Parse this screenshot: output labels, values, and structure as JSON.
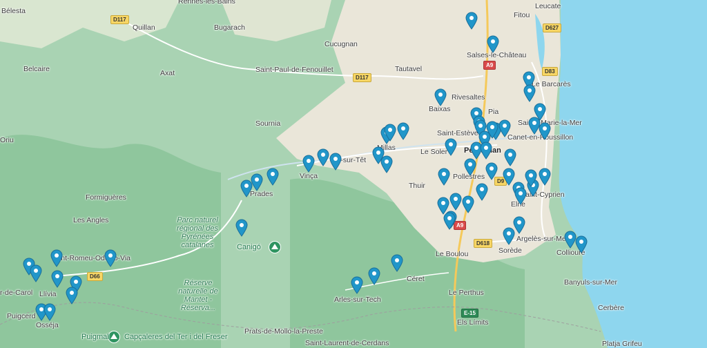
{
  "map": {
    "colors": {
      "sea": "#8ed6ee",
      "lowland": "#eae6d9",
      "mountain": "#a9d3b3",
      "forest": "#8fc69d",
      "road": "#ffffff",
      "highway": "#f5c95a",
      "pin": "#2196c9"
    },
    "places": [
      {
        "id": "belesta",
        "name": "Bélesta"
      },
      {
        "id": "rennes",
        "name": "Rennes-les-Bains"
      },
      {
        "id": "quillan",
        "name": "Quillan"
      },
      {
        "id": "bugarach",
        "name": "Bugarach"
      },
      {
        "id": "cucugnan",
        "name": "Cucugnan"
      },
      {
        "id": "fitou",
        "name": "Fitou"
      },
      {
        "id": "leucate",
        "name": "Leucate"
      },
      {
        "id": "salses",
        "name": "Salses-le-Château"
      },
      {
        "id": "belcaire",
        "name": "Belcaire"
      },
      {
        "id": "axat",
        "name": "Axat"
      },
      {
        "id": "stpaul",
        "name": "Saint-Paul-de-Fenouillet"
      },
      {
        "id": "tautavel",
        "name": "Tautavel"
      },
      {
        "id": "barcares",
        "name": "Le Barcarès"
      },
      {
        "id": "rivesaltes",
        "name": "Rivesaltes"
      },
      {
        "id": "baixas",
        "name": "Baixas"
      },
      {
        "id": "pia",
        "name": "Pia"
      },
      {
        "id": "stlaurent",
        "name": "Sainte-Marie-la-Mer"
      },
      {
        "id": "sournia",
        "name": "Sournia"
      },
      {
        "id": "stesteve",
        "name": "Saint-Estève"
      },
      {
        "id": "canet",
        "name": "Canet-en-Roussillon"
      },
      {
        "id": "oriu",
        "name": "Oriu"
      },
      {
        "id": "millas",
        "name": "Millas"
      },
      {
        "id": "lesoler",
        "name": "Le Soler"
      },
      {
        "id": "perpignan",
        "name": "Perpignan"
      },
      {
        "id": "ille",
        "name": "Ille-sur-Têt"
      },
      {
        "id": "vinca",
        "name": "Vinça"
      },
      {
        "id": "pollestres",
        "name": "Pollestres"
      },
      {
        "id": "thuir",
        "name": "Thuir"
      },
      {
        "id": "prades",
        "name": "Prades"
      },
      {
        "id": "stcyprien",
        "name": "Saint-Cyprien"
      },
      {
        "id": "formigueres",
        "name": "Formiguères"
      },
      {
        "id": "elne",
        "name": "Elne"
      },
      {
        "id": "lesangles",
        "name": "Les Angles"
      },
      {
        "id": "argeles",
        "name": "Argelès-sur-Mer"
      },
      {
        "id": "collioure",
        "name": "Collioure"
      },
      {
        "id": "sorede",
        "name": "Sorède"
      },
      {
        "id": "leboulou",
        "name": "Le Boulou"
      },
      {
        "id": "fontromeu",
        "name": "Font-Romeu-Odeillo-Via"
      },
      {
        "id": "ceret",
        "name": "Céret"
      },
      {
        "id": "banyuls",
        "name": "Banyuls-sur-Mer"
      },
      {
        "id": "bourgmadame",
        "name": "r-de-Carol"
      },
      {
        "id": "llivia",
        "name": "Llívia"
      },
      {
        "id": "arles",
        "name": "Arles-sur-Tech"
      },
      {
        "id": "leperthus",
        "name": "Le Perthus"
      },
      {
        "id": "cerbere",
        "name": "Cerbère"
      },
      {
        "id": "puigcerda",
        "name": "Puigcerd"
      },
      {
        "id": "osseja",
        "name": "Osséja"
      },
      {
        "id": "leslimits",
        "name": "Els Límits"
      },
      {
        "id": "pratsmollo",
        "name": "Prats-de-Mollo-la-Preste"
      },
      {
        "id": "stlaurentcerdans",
        "name": "Saint-Laurent-de-Cerdans"
      },
      {
        "id": "platja",
        "name": "Platja Grifeu"
      }
    ],
    "parks": [
      {
        "id": "pyrenees",
        "name": "Parc naturel régional des Pyrénées catalanes"
      },
      {
        "id": "mantet",
        "name": "Réserve naturelle de Mantet - Réserva..."
      }
    ],
    "pois": [
      {
        "id": "canigo",
        "name": "Canigó"
      },
      {
        "id": "puigmal",
        "name": "Puigmal"
      },
      {
        "id": "capcaleres",
        "name": "Capçaleres del Ter i del Freser"
      }
    ],
    "roads": [
      {
        "id": "d117a",
        "label": "D117"
      },
      {
        "id": "d117b",
        "label": "D117"
      },
      {
        "id": "d627",
        "label": "D627"
      },
      {
        "id": "a9a",
        "label": "A9"
      },
      {
        "id": "d83",
        "label": "D83"
      },
      {
        "id": "d9",
        "label": "D9"
      },
      {
        "id": "a9b",
        "label": "A9"
      },
      {
        "id": "d618",
        "label": "D618"
      },
      {
        "id": "d66",
        "label": "D66"
      },
      {
        "id": "e15",
        "label": "E-15"
      }
    ],
    "pin_count": 62
  }
}
